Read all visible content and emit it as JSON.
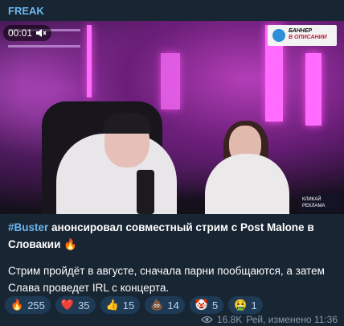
{
  "channel": {
    "name": "FREAK"
  },
  "video": {
    "timestamp": "00:01",
    "banner": {
      "line1": "БАННЕР",
      "line2": "В ОПИСАНИИ"
    },
    "promo": {
      "line1": "КЛИКАЙ",
      "line2": "РЕКЛАМА"
    }
  },
  "post": {
    "hashtag": "#Buster",
    "title_rest": " анонсировал совместный стрим с Post Malone в Словакии 🔥",
    "body": "Стрим пройдёт в августе, сначала парни пообщаются, а затем Слава проведет IRL с концерта."
  },
  "reactions": [
    {
      "emoji": "🔥",
      "count": "255"
    },
    {
      "emoji": "❤️",
      "count": "35"
    },
    {
      "emoji": "👍",
      "count": "15"
    },
    {
      "emoji": "💩",
      "count": "14"
    },
    {
      "emoji": "🤡",
      "count": "5"
    },
    {
      "emoji": "🤮",
      "count": "1"
    }
  ],
  "meta": {
    "views": "16.8K",
    "edited": "Рей, изменено 11:36"
  }
}
